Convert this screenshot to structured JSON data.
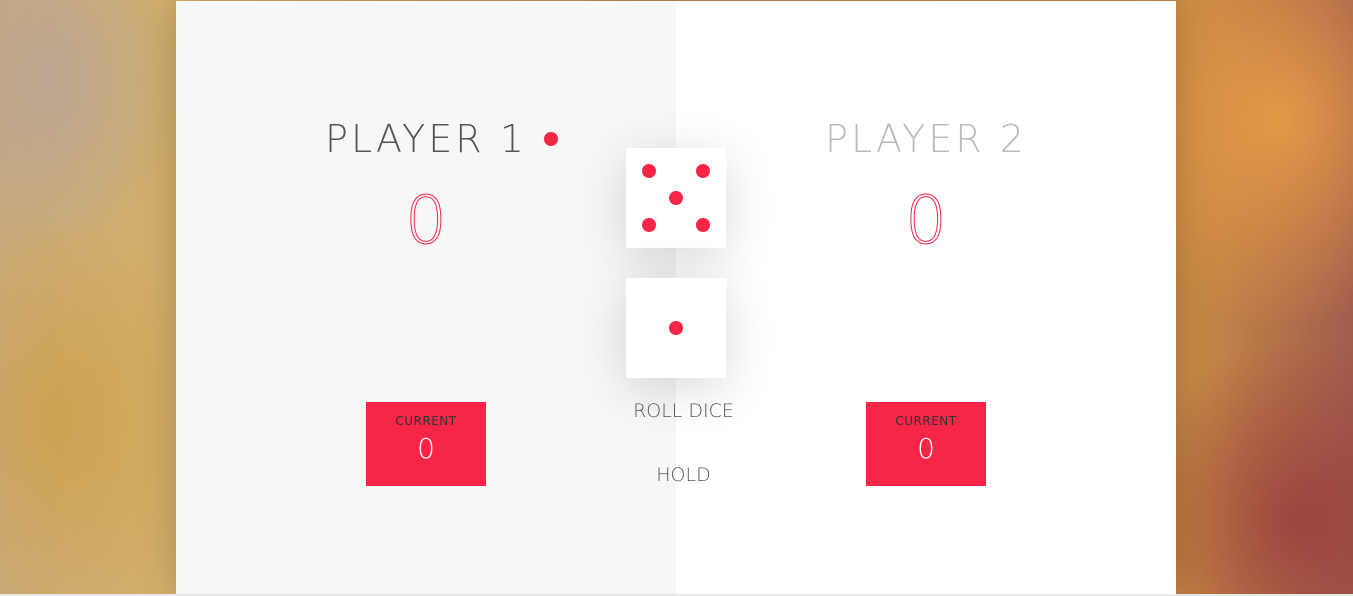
{
  "players": [
    {
      "name": "PLAYER 1",
      "score": "0",
      "current_label": "CURRENT",
      "current_value": "0",
      "active": true
    },
    {
      "name": "PLAYER 2",
      "score": "0",
      "current_label": "CURRENT",
      "current_value": "0",
      "active": false
    }
  ],
  "dice": [
    {
      "face": 5
    },
    {
      "face": 1
    }
  ],
  "buttons": {
    "roll": "ROLL DICE",
    "hold": "HOLD"
  },
  "colors": {
    "accent": "#f72648",
    "panel_active": "#f7f7f7",
    "panel_inactive": "#ffffff"
  }
}
